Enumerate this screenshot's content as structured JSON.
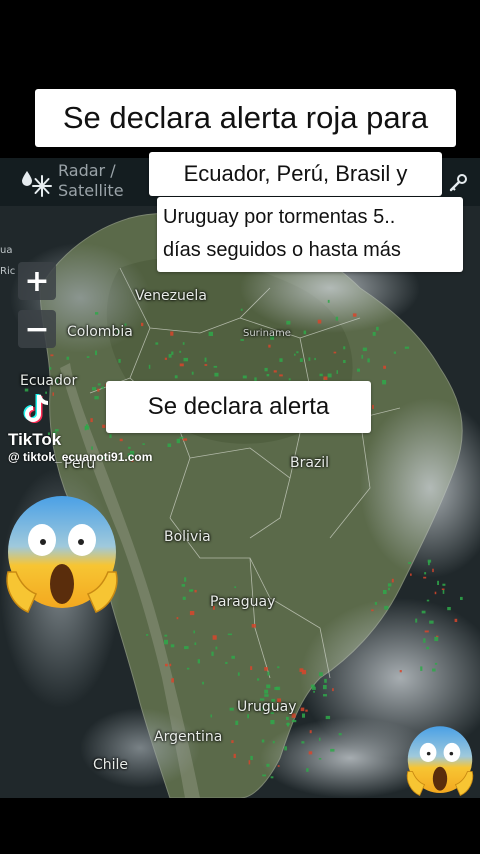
{
  "captions": {
    "line1": "Se declara alerta roja para",
    "line2": "Ecuador, Perú,  Brasil y",
    "line3a": "Uruguay por tormentas 5..",
    "line3b": "días seguidos o hasta más",
    "middle": "Se declara alerta"
  },
  "radar": {
    "label_line1": "Radar /",
    "label_line2": "Satellite",
    "icon": "snowflake-rain-icon",
    "settings_icon": "key-icon"
  },
  "map_controls": {
    "zoom_in": "+",
    "zoom_out": "−"
  },
  "edge_labels": {
    "a": "ua",
    "b": "Ric"
  },
  "countries": {
    "venezuela": "Venezuela",
    "colombia": "Colombia",
    "suriname": "Suriname",
    "ecuador": "Ecuador",
    "peru": "Peru",
    "brazil": "Brazil",
    "bolivia": "Bolivia",
    "paraguay": "Paraguay",
    "uruguay": "Uruguay",
    "argentina": "Argentina",
    "chile": "Chile"
  },
  "tiktok": {
    "name": "TikTok",
    "handle": "@ tiktok_ecuanoti91.com"
  },
  "colors": {
    "background": "#000000",
    "land": "#5d6a4c",
    "ocean": "#1b2124",
    "clouds": "#aeb6bb",
    "radar_green": "#2fa84a",
    "radar_red": "#d8452c",
    "caption_bg": "#ffffff"
  }
}
